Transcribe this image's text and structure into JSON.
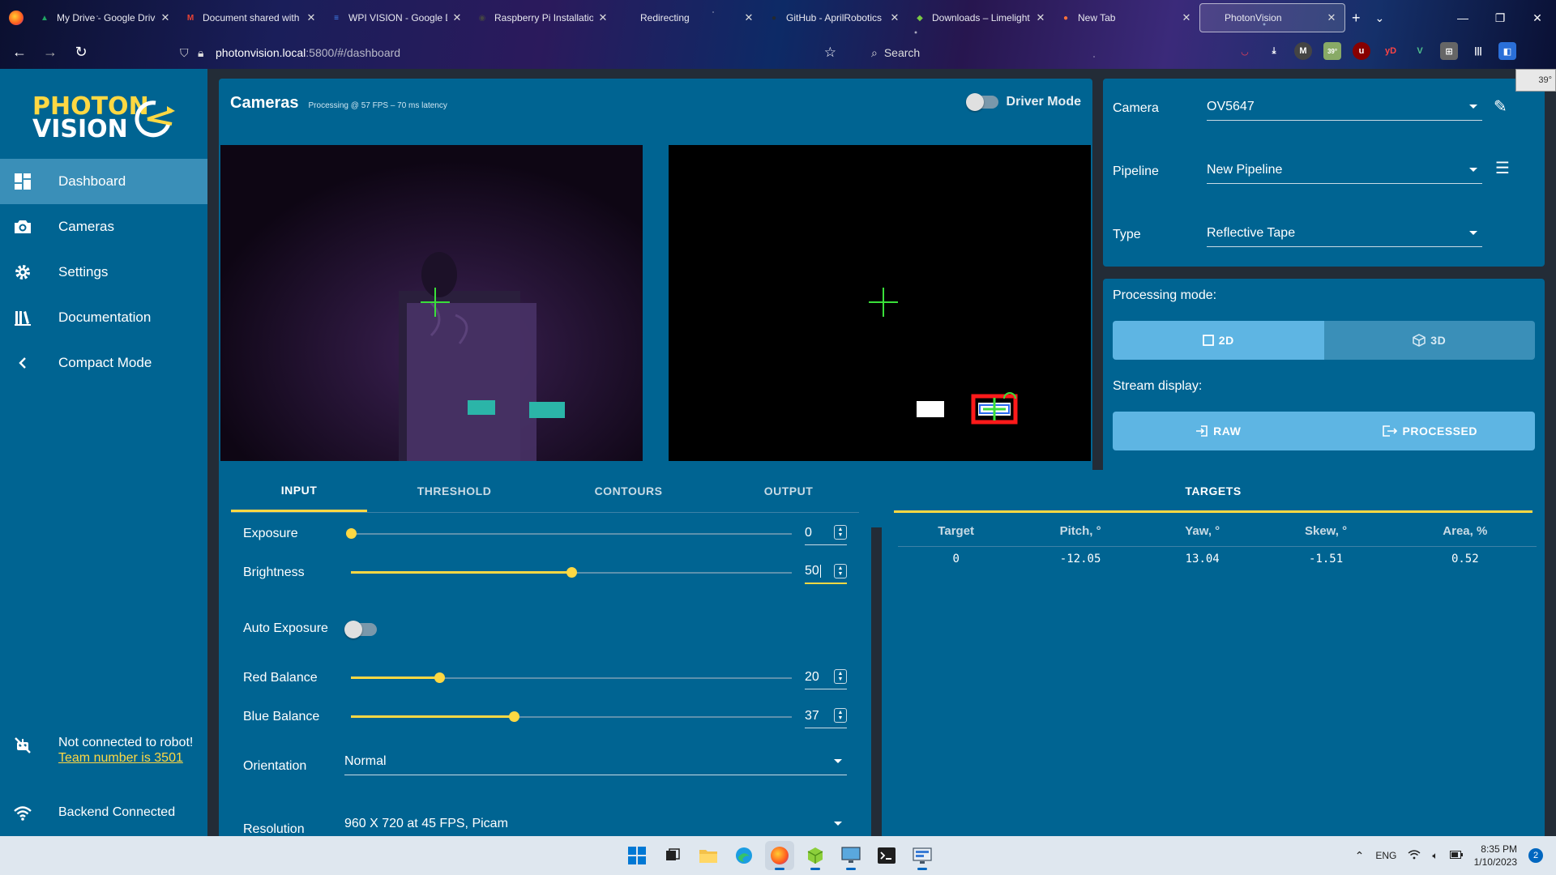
{
  "browser": {
    "tabs": [
      {
        "title": "My Drive - Google Drive",
        "fav_color": "#1fa463",
        "fav_glyph": "▲"
      },
      {
        "title": "Document shared with you",
        "fav_color": "#ea4335",
        "fav_glyph": "M"
      },
      {
        "title": "WPI VISION - Google Docs",
        "fav_color": "#4285f4",
        "fav_glyph": "≡"
      },
      {
        "title": "Raspberry Pi Installation",
        "fav_color": "#444444",
        "fav_glyph": "◉"
      },
      {
        "title": "Redirecting",
        "fav_color": "",
        "fav_glyph": ""
      },
      {
        "title": "GitHub - AprilRobotics",
        "fav_color": "#24292e",
        "fav_glyph": "●"
      },
      {
        "title": "Downloads – Limelight",
        "fav_color": "#7ac943",
        "fav_glyph": "◆"
      },
      {
        "title": "New Tab",
        "fav_color": "#ff7139",
        "fav_glyph": "●"
      },
      {
        "title": "PhotonVision",
        "fav_color": "",
        "fav_glyph": ""
      }
    ],
    "url_host": "photonvision.local",
    "url_rest": ":5800/#/dashboard",
    "search_placeholder": "Search",
    "weather": "39°",
    "ext_badge": "39°"
  },
  "sidebar": {
    "logo_line1": "PHOTON",
    "logo_line2": "VISION",
    "items": [
      {
        "label": "Dashboard",
        "icon": "dashboard-icon"
      },
      {
        "label": "Cameras",
        "icon": "camera-icon"
      },
      {
        "label": "Settings",
        "icon": "gear-icon"
      },
      {
        "label": "Documentation",
        "icon": "books-icon"
      },
      {
        "label": "Compact Mode",
        "icon": "chevron-left-icon"
      }
    ],
    "robot_status": "Not connected to robot!",
    "team_number": "Team number is 3501",
    "backend_status": "Backend Connected"
  },
  "cameras": {
    "title": "Cameras",
    "processing_info": "Processing @ 57 FPS – 70 ms latency",
    "driver_mode_label": "Driver Mode"
  },
  "config": {
    "camera_label": "Camera",
    "camera_value": "OV5647",
    "pipeline_label": "Pipeline",
    "pipeline_value": "New Pipeline",
    "type_label": "Type",
    "type_value": "Reflective Tape",
    "processing_mode_label": "Processing mode:",
    "mode_2d": "2D",
    "mode_3d": "3D",
    "stream_display_label": "Stream display:",
    "raw_label": "RAW",
    "processed_label": "PROCESSED"
  },
  "tuning": {
    "tabs": [
      "INPUT",
      "THRESHOLD",
      "CONTOURS",
      "OUTPUT"
    ],
    "exposure_label": "Exposure",
    "exposure_value": "0",
    "exposure_level": 0,
    "brightness_label": "Brightness",
    "brightness_value": "50",
    "brightness_level": 0.5,
    "auto_exposure_label": "Auto Exposure",
    "red_balance_label": "Red Balance",
    "red_balance_value": "20",
    "red_balance_level": 0.2,
    "blue_balance_label": "Blue Balance",
    "blue_balance_value": "37",
    "blue_balance_level": 0.37,
    "orientation_label": "Orientation",
    "orientation_value": "Normal",
    "resolution_label": "Resolution",
    "resolution_value": "960 X 720 at 45 FPS, Picam"
  },
  "targets": {
    "title": "TARGETS",
    "columns": [
      "Target",
      "Pitch, °",
      "Yaw, °",
      "Skew, °",
      "Area, %"
    ],
    "rows": [
      [
        "0",
        "-12.05",
        "13.04",
        "-1.51",
        "0.52"
      ]
    ]
  },
  "taskbar": {
    "lang": "ENG",
    "time": "8:35 PM",
    "date": "1/10/2023",
    "notifications": "2"
  },
  "colors": {
    "sidebar": "#006492",
    "card": "#006492",
    "background": "#232c37",
    "accent_yellow": "#ffd843",
    "active_button": "#5eb5e3",
    "inactive_button": "#3a8fb8"
  }
}
